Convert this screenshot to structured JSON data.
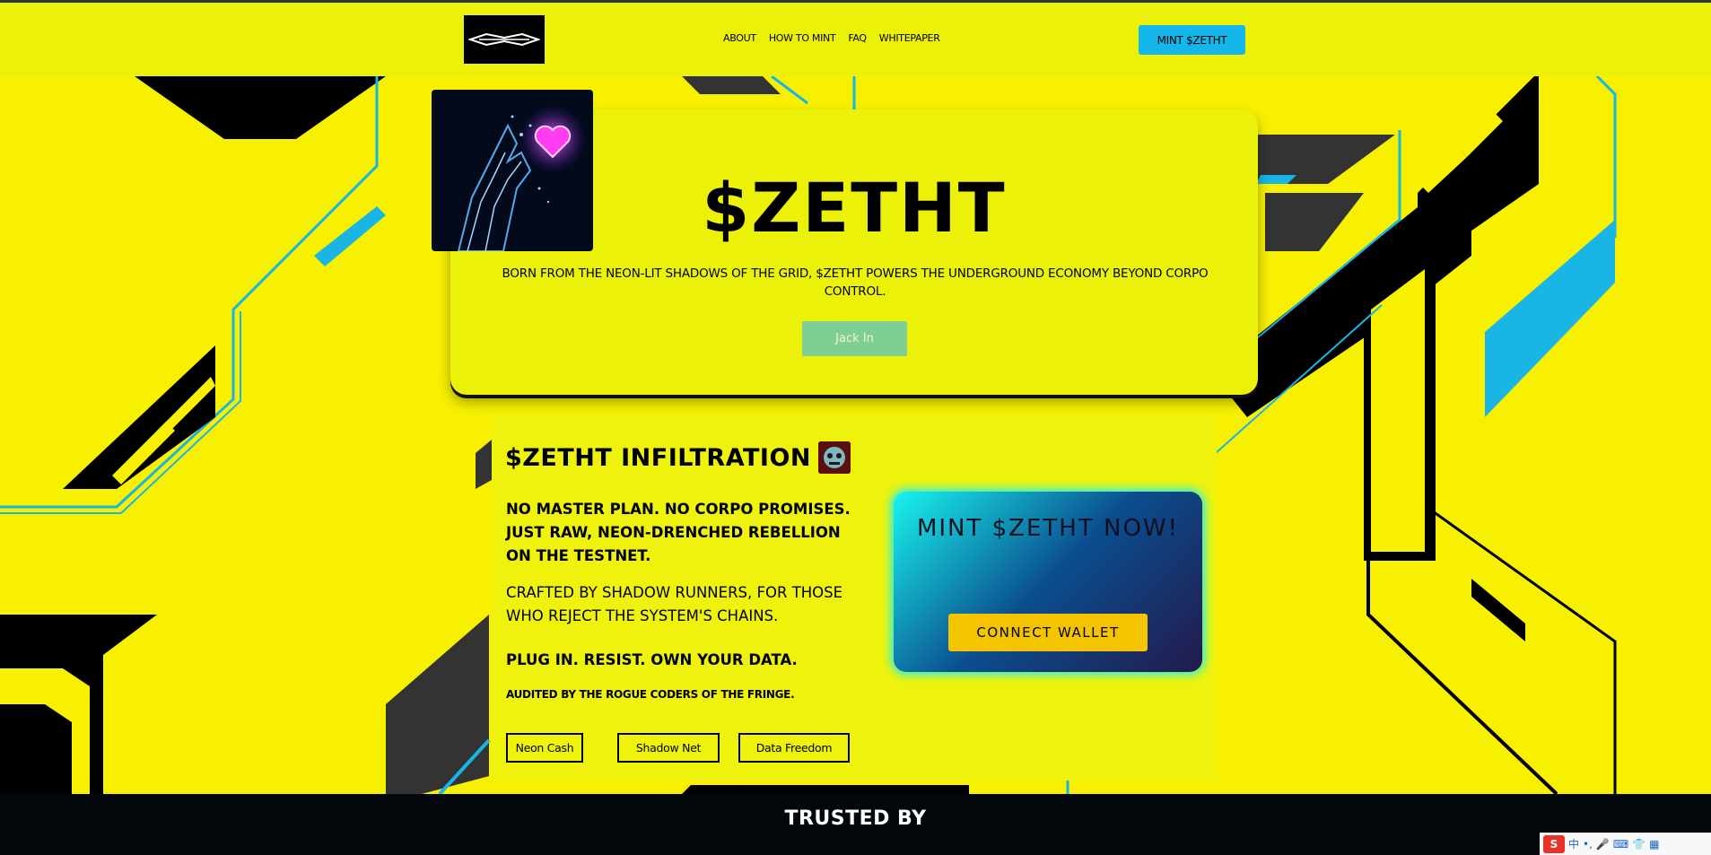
{
  "header": {
    "logo_alt": "logo",
    "nav": [
      "ABOUT",
      "HOW TO MINT",
      "FAQ",
      "WHITEPAPER"
    ],
    "cta": "MINT $ZETHT"
  },
  "hero": {
    "title": "$ZETHT",
    "description": "BORN FROM THE NEON-LIT SHADOWS OF THE GRID, $ZETHT POWERS THE UNDERGROUND ECONOMY BEYOND CORPO CONTROL.",
    "button": "Jack In"
  },
  "infiltration": {
    "title": "$ZETHT INFILTRATION",
    "bold_text": "NO MASTER PLAN. NO CORPO PROMISES. JUST RAW, NEON-DRENCHED REBELLION ON THE TESTNET.",
    "regular_text": "CRAFTED BY SHADOW RUNNERS, FOR THOSE WHO REJECT THE SYSTEM'S CHAINS.",
    "bold_text_2": "PLUG IN. RESIST. OWN YOUR DATA.",
    "audit_text": "AUDITED BY THE ROGUE CODERS OF THE FRINGE.",
    "tags": [
      "Neon Cash",
      "Shadow Net",
      "Data Freedom"
    ]
  },
  "mint_box": {
    "title": "MINT $ZETHT NOW!",
    "button": "CONNECT WALLET"
  },
  "footer": {
    "heading": "TRUSTED BY"
  },
  "tray": {
    "ime_char": "中"
  },
  "colors": {
    "background": "#f7f000",
    "accent_blue": "#15b6ea",
    "button_yellow": "#f5c400",
    "jack_in_green": "#7fcf95",
    "mint_gradient_start": "#18f5ee",
    "mint_gradient_end": "#231a4b"
  }
}
